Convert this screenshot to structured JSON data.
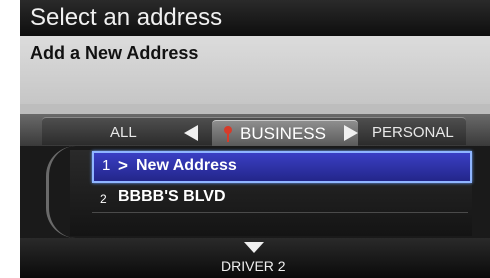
{
  "screen": {
    "title": "Select an address",
    "subtitle": "Add a New Address"
  },
  "tabs": {
    "all": "ALL",
    "business": "BUSINESS",
    "personal": "PERSONAL",
    "active": "BUSINESS"
  },
  "list": {
    "items": [
      {
        "number": "1",
        "arrow": ">",
        "label": "New Address",
        "selected": true
      },
      {
        "number": "2",
        "label": "BBBB'S BLVD",
        "selected": false
      }
    ]
  },
  "footer": {
    "driver": "DRIVER 2"
  },
  "colors": {
    "highlight": "#2a2fa8",
    "highlight_border": "#8fb5ff",
    "pin": "#d63b2a"
  },
  "icons": {
    "left": "triangle-left-icon",
    "right": "triangle-right-icon",
    "down": "triangle-down-icon",
    "pin": "map-pin-icon"
  }
}
